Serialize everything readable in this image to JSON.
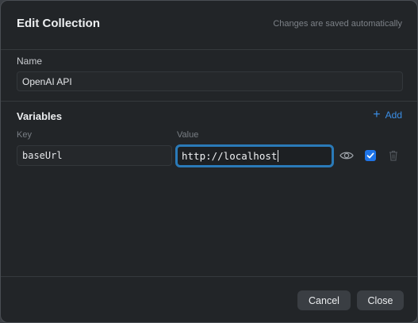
{
  "dialog": {
    "title": "Edit Collection",
    "autosave_note": "Changes are saved automatically"
  },
  "name_section": {
    "label": "Name",
    "value": "OpenAI API"
  },
  "variables": {
    "title": "Variables",
    "add_label": "Add",
    "key_header": "Key",
    "value_header": "Value",
    "rows": [
      {
        "key": "baseUrl",
        "value": "http://localhost",
        "enabled": true
      }
    ]
  },
  "footer": {
    "cancel_label": "Cancel",
    "close_label": "Close"
  },
  "colors": {
    "accent": "#1e74e8",
    "link": "#3b8fe8",
    "focus_ring": "#2a7ab8",
    "background": "#222528"
  },
  "icons": {
    "add": "plus-icon",
    "visibility": "eye-icon",
    "enabled": "checkbox-checked-icon",
    "delete": "trash-icon"
  }
}
